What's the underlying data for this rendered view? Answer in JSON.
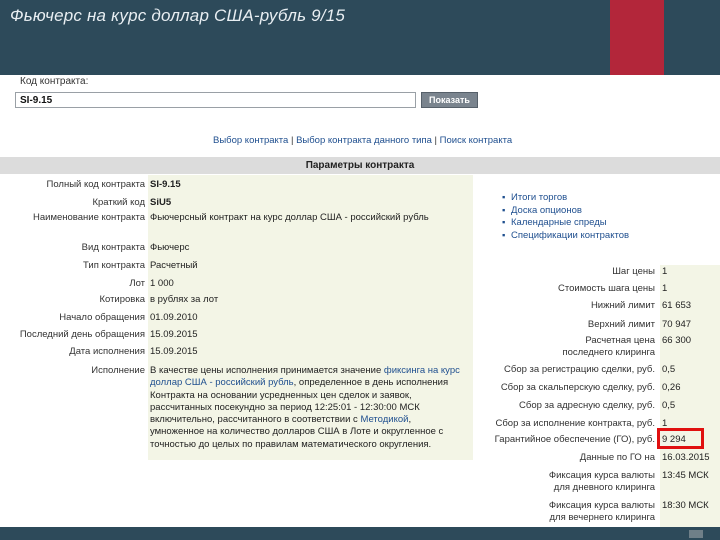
{
  "slide": {
    "title": "Фьючерс на курс доллар США-рубль 9/15"
  },
  "contract_code": {
    "label": "Код контракта:",
    "value": "SI-9.15",
    "show_button": "Показать"
  },
  "nav": {
    "choose_contract": "Выбор контракта",
    "separator": "|",
    "choose_contract_type": "Выбор контракта данного типа",
    "search_contract": "Поиск контракта"
  },
  "params": {
    "header": "Параметры контракта",
    "rows": [
      {
        "label": "Полный код контракта",
        "value": "SI-9.15"
      },
      {
        "label": "Краткий код",
        "value": "SiU5"
      },
      {
        "label": "Наименование контракта",
        "value": "Фьючерсный контракт на курс доллар США - российский рубль"
      },
      {
        "label": "Вид контракта",
        "value": "Фьючерс"
      },
      {
        "label": "Тип контракта",
        "value": "Расчетный"
      },
      {
        "label": "Лот",
        "value": "1 000"
      },
      {
        "label": "Котировка",
        "value": "в рублях за лот"
      },
      {
        "label": "Начало обращения",
        "value": "01.09.2010"
      },
      {
        "label": "Последний день обращения",
        "value": "15.09.2015"
      },
      {
        "label": "Дата исполнения",
        "value": "15.09.2015"
      }
    ],
    "execution": {
      "label": "Исполнение",
      "text_part1": "В качестве цены исполнения принимается значение ",
      "link_fixing": "фиксинга на курс доллар США - российский рубль",
      "text_part2": ", определенное в день исполнения Контракта на основании усредненных цен сделок и заявок, рассчитанных посекундно за период 12:25:01 - 12:30:00 МСК включительно, рассчитанного в соответствии с ",
      "link_method": "Методикой",
      "text_part3": ", умноженное на количество долларов США в Лоте и округленное с точностью до целых по правилам математического округления."
    }
  },
  "side_links": [
    "Итоги торгов",
    "Доска опционов",
    "Календарные спреды",
    "Спецификации контрактов"
  ],
  "right_params": [
    {
      "label": "Шаг цены",
      "value": "1"
    },
    {
      "label": "Стоимость шага цены",
      "value": "1"
    },
    {
      "label": "Нижний лимит",
      "value": "61 653"
    },
    {
      "label": "Верхний лимит",
      "value": "70 947"
    },
    {
      "label1": "Расчетная цена",
      "label2": "последнего клиринга",
      "value": "66 300"
    },
    {
      "label": "Сбор за регистрацию сделки, руб.",
      "value": "0,5"
    },
    {
      "label": "Сбор за скальперскую сделку, руб.",
      "value": "0,26"
    },
    {
      "label": "Сбор за адресную сделку, руб.",
      "value": "0,5"
    },
    {
      "label": "Сбор за исполнение контракта, руб.",
      "value": "1"
    },
    {
      "label": "Гарантийное обеспечение (ГО), руб.",
      "value": "9 294"
    },
    {
      "label": "Данные по ГО на",
      "value": "16.03.2015"
    },
    {
      "label1": "Фиксация курса валюты",
      "label2": "для дневного клиринга",
      "value": "13:45 МСК"
    },
    {
      "label1": "Фиксация курса валюты",
      "label2": "для вечернего клиринга",
      "value": "18:30 МСК"
    }
  ],
  "colors": {
    "slide_bar": "#2d4a5a",
    "accent": "#b3263a",
    "highlight": "#e01010",
    "link": "#1f4f8f"
  }
}
